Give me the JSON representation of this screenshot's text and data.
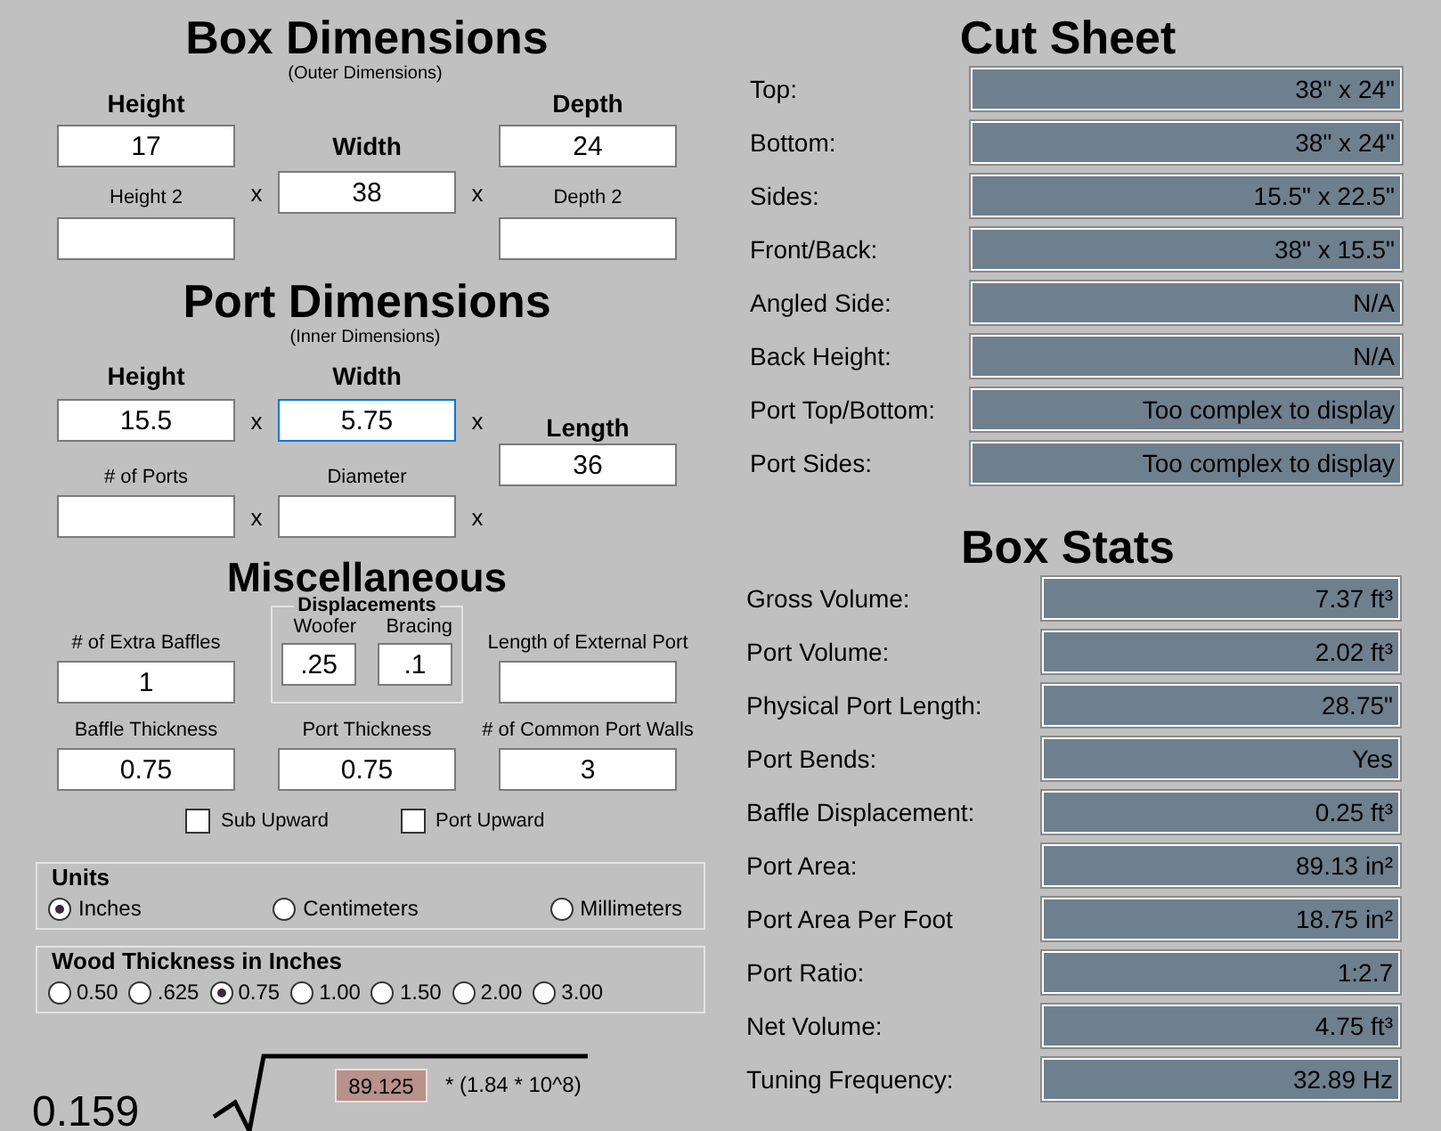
{
  "box_dimensions": {
    "title": "Box Dimensions",
    "subtitle": "(Outer Dimensions)",
    "height": {
      "label": "Height",
      "value": "17"
    },
    "width": {
      "label": "Width",
      "value": "38"
    },
    "depth": {
      "label": "Depth",
      "value": "24"
    },
    "height_2": {
      "label": "Height 2"
    },
    "depth_2": {
      "label": "Depth 2"
    },
    "separators": [
      "x",
      "x"
    ]
  },
  "port_dimensions": {
    "title": "Port Dimensions",
    "subtitle": "(Inner Dimensions)",
    "height": {
      "label": "Height",
      "value": "15.5",
      "focused": false
    },
    "width": {
      "label": "Width",
      "value": "5.75",
      "focused": true
    },
    "length": {
      "label": "Length",
      "value": "36",
      "focused": false
    },
    "ports_count": {
      "label": "# of Ports",
      "focused": false
    },
    "diameter": {
      "label": "Diameter",
      "focused": false
    },
    "separators": [
      "x",
      "x",
      "x",
      "x"
    ]
  },
  "miscellaneous": {
    "title": "Miscellaneous",
    "extra_baffles": {
      "label": "# of Extra Baffles",
      "value": "1"
    },
    "displacements": {
      "title": "Displacements",
      "woofer": {
        "label": "Woofer",
        "value": ".25"
      },
      "bracing": {
        "label": "Bracing",
        "value": ".1"
      }
    },
    "external_port_length": {
      "label": "Length of External Port"
    },
    "baffle_thickness": {
      "label": "Baffle Thickness",
      "value": "0.75"
    },
    "port_thickness": {
      "label": "Port Thickness",
      "value": "0.75"
    },
    "common_port_walls": {
      "label": "# of Common Port Walls",
      "value": "3"
    },
    "checkboxes": [
      {
        "label": "Sub Upward",
        "checked": false
      },
      {
        "label": "Port Upward",
        "checked": false
      }
    ]
  },
  "units": {
    "title": "Units",
    "options": [
      {
        "label": "Inches",
        "selected": true
      },
      {
        "label": "Centimeters",
        "selected": false
      },
      {
        "label": "Millimeters",
        "selected": false
      }
    ]
  },
  "wood_thickness": {
    "title": "Wood Thickness in Inches",
    "options": [
      {
        "label": "0.50",
        "selected": false
      },
      {
        "label": ".625",
        "selected": false
      },
      {
        "label": "0.75",
        "selected": true
      },
      {
        "label": "1.00",
        "selected": false
      },
      {
        "label": "1.50",
        "selected": false
      },
      {
        "label": "2.00",
        "selected": false
      },
      {
        "label": "3.00",
        "selected": false
      }
    ]
  },
  "formula": {
    "coefficient": "0.159",
    "value": "89.125",
    "multiplier": "* (1.84 * 10^8)"
  },
  "cut_sheet": {
    "title": "Cut Sheet",
    "rows": [
      {
        "label": "Top:",
        "value": "38\" x 24\""
      },
      {
        "label": "Bottom:",
        "value": "38\" x 24\""
      },
      {
        "label": "Sides:",
        "value": "15.5\" x 22.5\""
      },
      {
        "label": "Front/Back:",
        "value": "38\" x 15.5\""
      },
      {
        "label": "Angled Side:",
        "value": "N/A"
      },
      {
        "label": "Back Height:",
        "value": "N/A"
      },
      {
        "label": "Port Top/Bottom:",
        "value": "Too complex to display"
      },
      {
        "label": "Port Sides:",
        "value": "Too complex to display"
      }
    ]
  },
  "box_stats": {
    "title": "Box Stats",
    "rows": [
      {
        "label": "Gross Volume:",
        "value": "7.37 ft³"
      },
      {
        "label": "Port Volume:",
        "value": "2.02 ft³"
      },
      {
        "label": "Physical Port Length:",
        "value": "28.75\""
      },
      {
        "label": "Port Bends:",
        "value": "Yes"
      },
      {
        "label": "Baffle Displacement:",
        "value": "0.25 ft³"
      },
      {
        "label": "Port Area:",
        "value": "89.13 in²"
      },
      {
        "label": "Port Area Per Foot",
        "value": "18.75 in²"
      },
      {
        "label": "Port Ratio:",
        "value": "1:2.7"
      },
      {
        "label": "Net Volume:",
        "value": "4.75 ft³"
      },
      {
        "label": "Tuning Frequency:",
        "value": "32.89 Hz"
      }
    ]
  }
}
